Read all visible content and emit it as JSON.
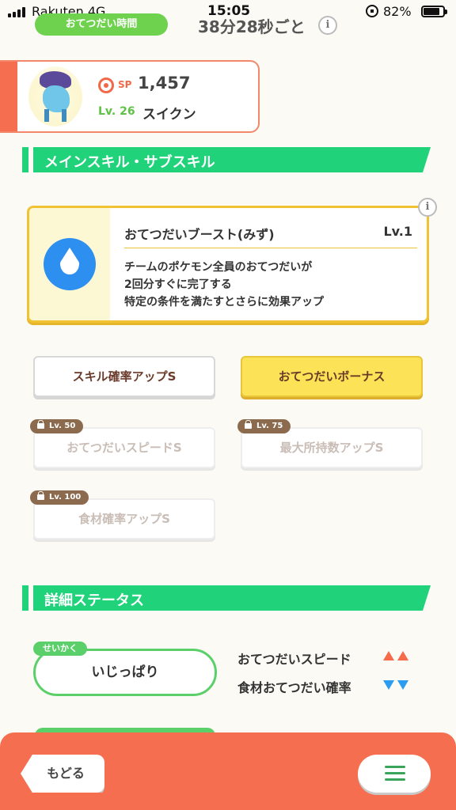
{
  "status_bar": {
    "carrier": "Rakuten  4G",
    "time": "15:05",
    "battery": "82%"
  },
  "top": {
    "help_time_label": "おてつだい時間",
    "help_time_value": "38分28秒ごと",
    "info_glyph": "i"
  },
  "pokemon": {
    "sp_label": "SP",
    "sp_value": "1,457",
    "level": "Lv. 26",
    "name": "スイクン"
  },
  "skills_section": {
    "title": "メインスキル・サブスキル",
    "main_skill": {
      "name": "おてつだいブースト(みず)",
      "level": "Lv.1",
      "description": [
        "チームのポケモン全員のおてつだいが",
        "2回分すぐに完了する",
        "特定の条件を満たすとさらに効果アップ"
      ],
      "icon": "water-drop-icon",
      "color": "#2d8ff0"
    },
    "sub_skills": [
      {
        "label": "スキル確率アップS",
        "locked": false,
        "style": "white"
      },
      {
        "label": "おてつだいボーナス",
        "locked": false,
        "style": "gold"
      },
      {
        "label": "おてつだいスピードS",
        "locked": true,
        "unlock_level": "Lv. 50"
      },
      {
        "label": "最大所持数アップS",
        "locked": true,
        "unlock_level": "Lv. 75"
      },
      {
        "label": "食材確率アップS",
        "locked": true,
        "unlock_level": "Lv. 100"
      }
    ]
  },
  "details_section": {
    "title": "詳細ステータス",
    "nature_tag": "せいかく",
    "nature": "いじっぱり",
    "stat_up": "おてつだいスピード",
    "stat_down": "食材おてつだい確率",
    "up_color": "#f76a4a",
    "down_color": "#2b9cf0"
  },
  "bottom": {
    "back_label": "もどる",
    "menu_icon": "hamburger-menu-icon"
  }
}
